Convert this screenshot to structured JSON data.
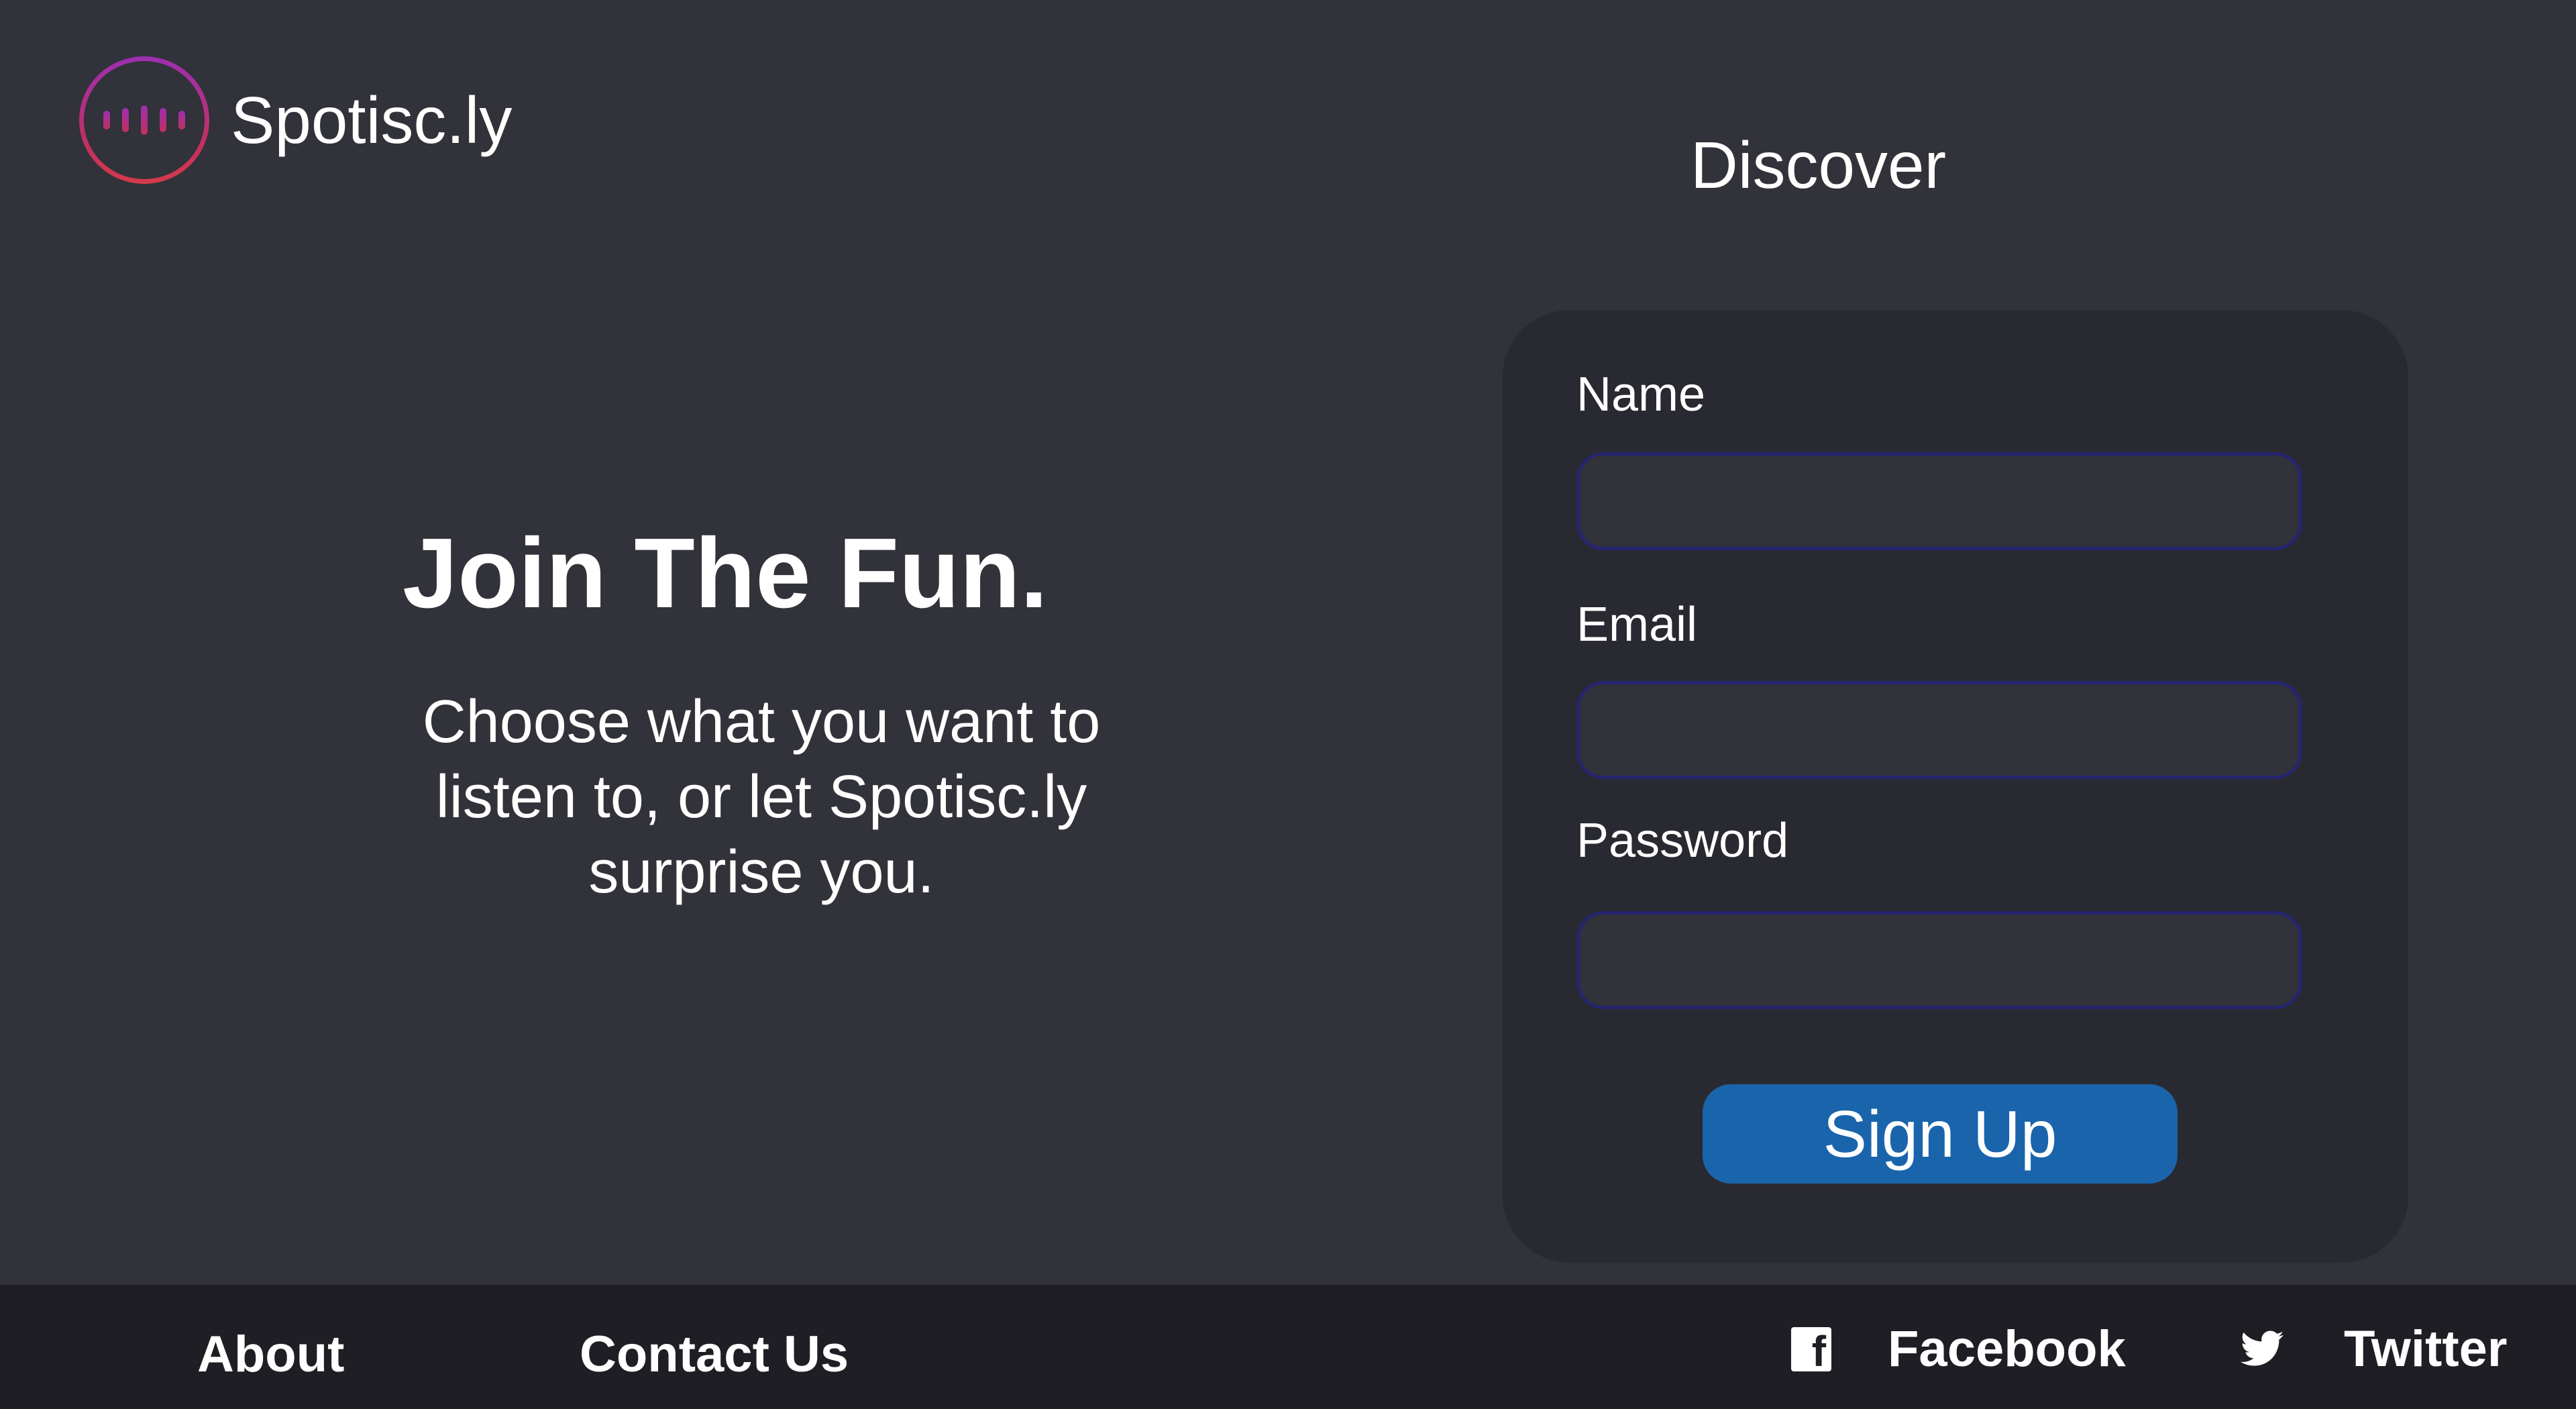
{
  "header": {
    "brand_name": "Spotisc.ly",
    "nav_discover": "Discover"
  },
  "hero": {
    "title": "Join The Fun.",
    "subtitle": "Choose what you want to listen to, or let Spotisc.ly surprise you."
  },
  "signup_form": {
    "name_label": "Name",
    "name_value": "",
    "email_label": "Email",
    "email_value": "",
    "password_label": "Password",
    "password_value": "",
    "submit_label": "Sign Up"
  },
  "footer": {
    "about": "About",
    "contact": "Contact Us",
    "facebook": "Facebook",
    "twitter": "Twitter"
  },
  "colors": {
    "background": "#31323a",
    "card": "#292a31",
    "footer": "#1e1e24",
    "accent_button": "#1a64ab",
    "input_border": "#25256f",
    "logo_gradient_start": "#9c2fb1",
    "logo_gradient_end": "#d63a4a"
  },
  "icons": [
    "logo-soundwave-icon",
    "facebook-icon",
    "twitter-icon"
  ]
}
